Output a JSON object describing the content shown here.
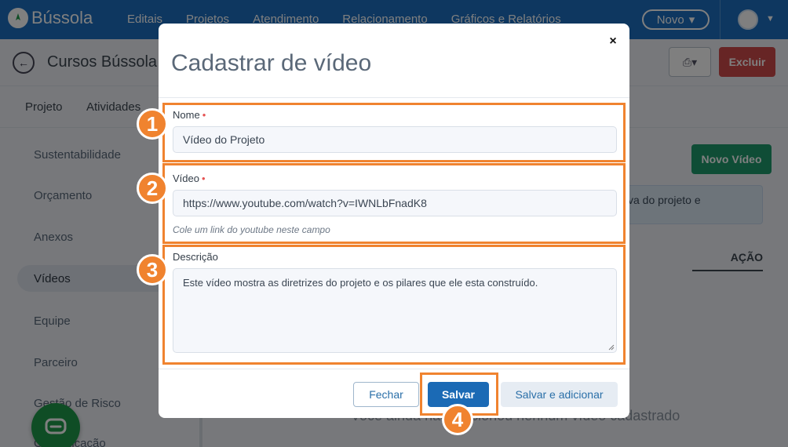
{
  "app": {
    "brand": "Bússola",
    "nav": [
      "Editais",
      "Projetos",
      "Atendimento",
      "Relacionamento",
      "Gráficos e Relatórios"
    ],
    "novo_label": "Novo"
  },
  "page": {
    "title": "Cursos Bússola",
    "excluir_label": "Excluir",
    "tabs": [
      "Projeto",
      "Atividades"
    ]
  },
  "sidebar": {
    "items": [
      {
        "label": "Sustentabilidade"
      },
      {
        "label": "Orçamento"
      },
      {
        "label": "Anexos"
      },
      {
        "label": "Vídeos"
      },
      {
        "label": "Equipe"
      },
      {
        "label": "Parceiro"
      },
      {
        "label": "Gestão de Risco"
      },
      {
        "label": "Comunicação"
      }
    ]
  },
  "content": {
    "novo_video_label": "Novo Vídeo",
    "info_text": "va do projeto e",
    "acao_header": "AÇÃO",
    "empty_text": "Você ainda não adicionou nenhum vídeo cadastrado"
  },
  "modal": {
    "title": "Cadastrar de vídeo",
    "close_label": "×",
    "nome_label": "Nome",
    "nome_value": "Vídeo do Projeto",
    "video_label": "Vídeo",
    "video_value": "https://www.youtube.com/watch?v=IWNLbFnadK8",
    "video_help": "Cole um link do youtube neste campo",
    "descricao_label": "Descrição",
    "descricao_value": "Este vídeo mostra as diretrizes do projeto e os pilares que ele esta construído.",
    "fechar_label": "Fechar",
    "salvar_label": "Salvar",
    "salvar_add_label": "Salvar e adicionar",
    "required_mark": "•"
  },
  "annotations": [
    "1",
    "2",
    "3",
    "4"
  ],
  "colors": {
    "nav_blue": "#1d6fc0",
    "annotation_orange": "#f0832f",
    "primary_button": "#1b6ab5",
    "danger_button": "#cf4b4b",
    "success_button": "#1f9b6d"
  }
}
